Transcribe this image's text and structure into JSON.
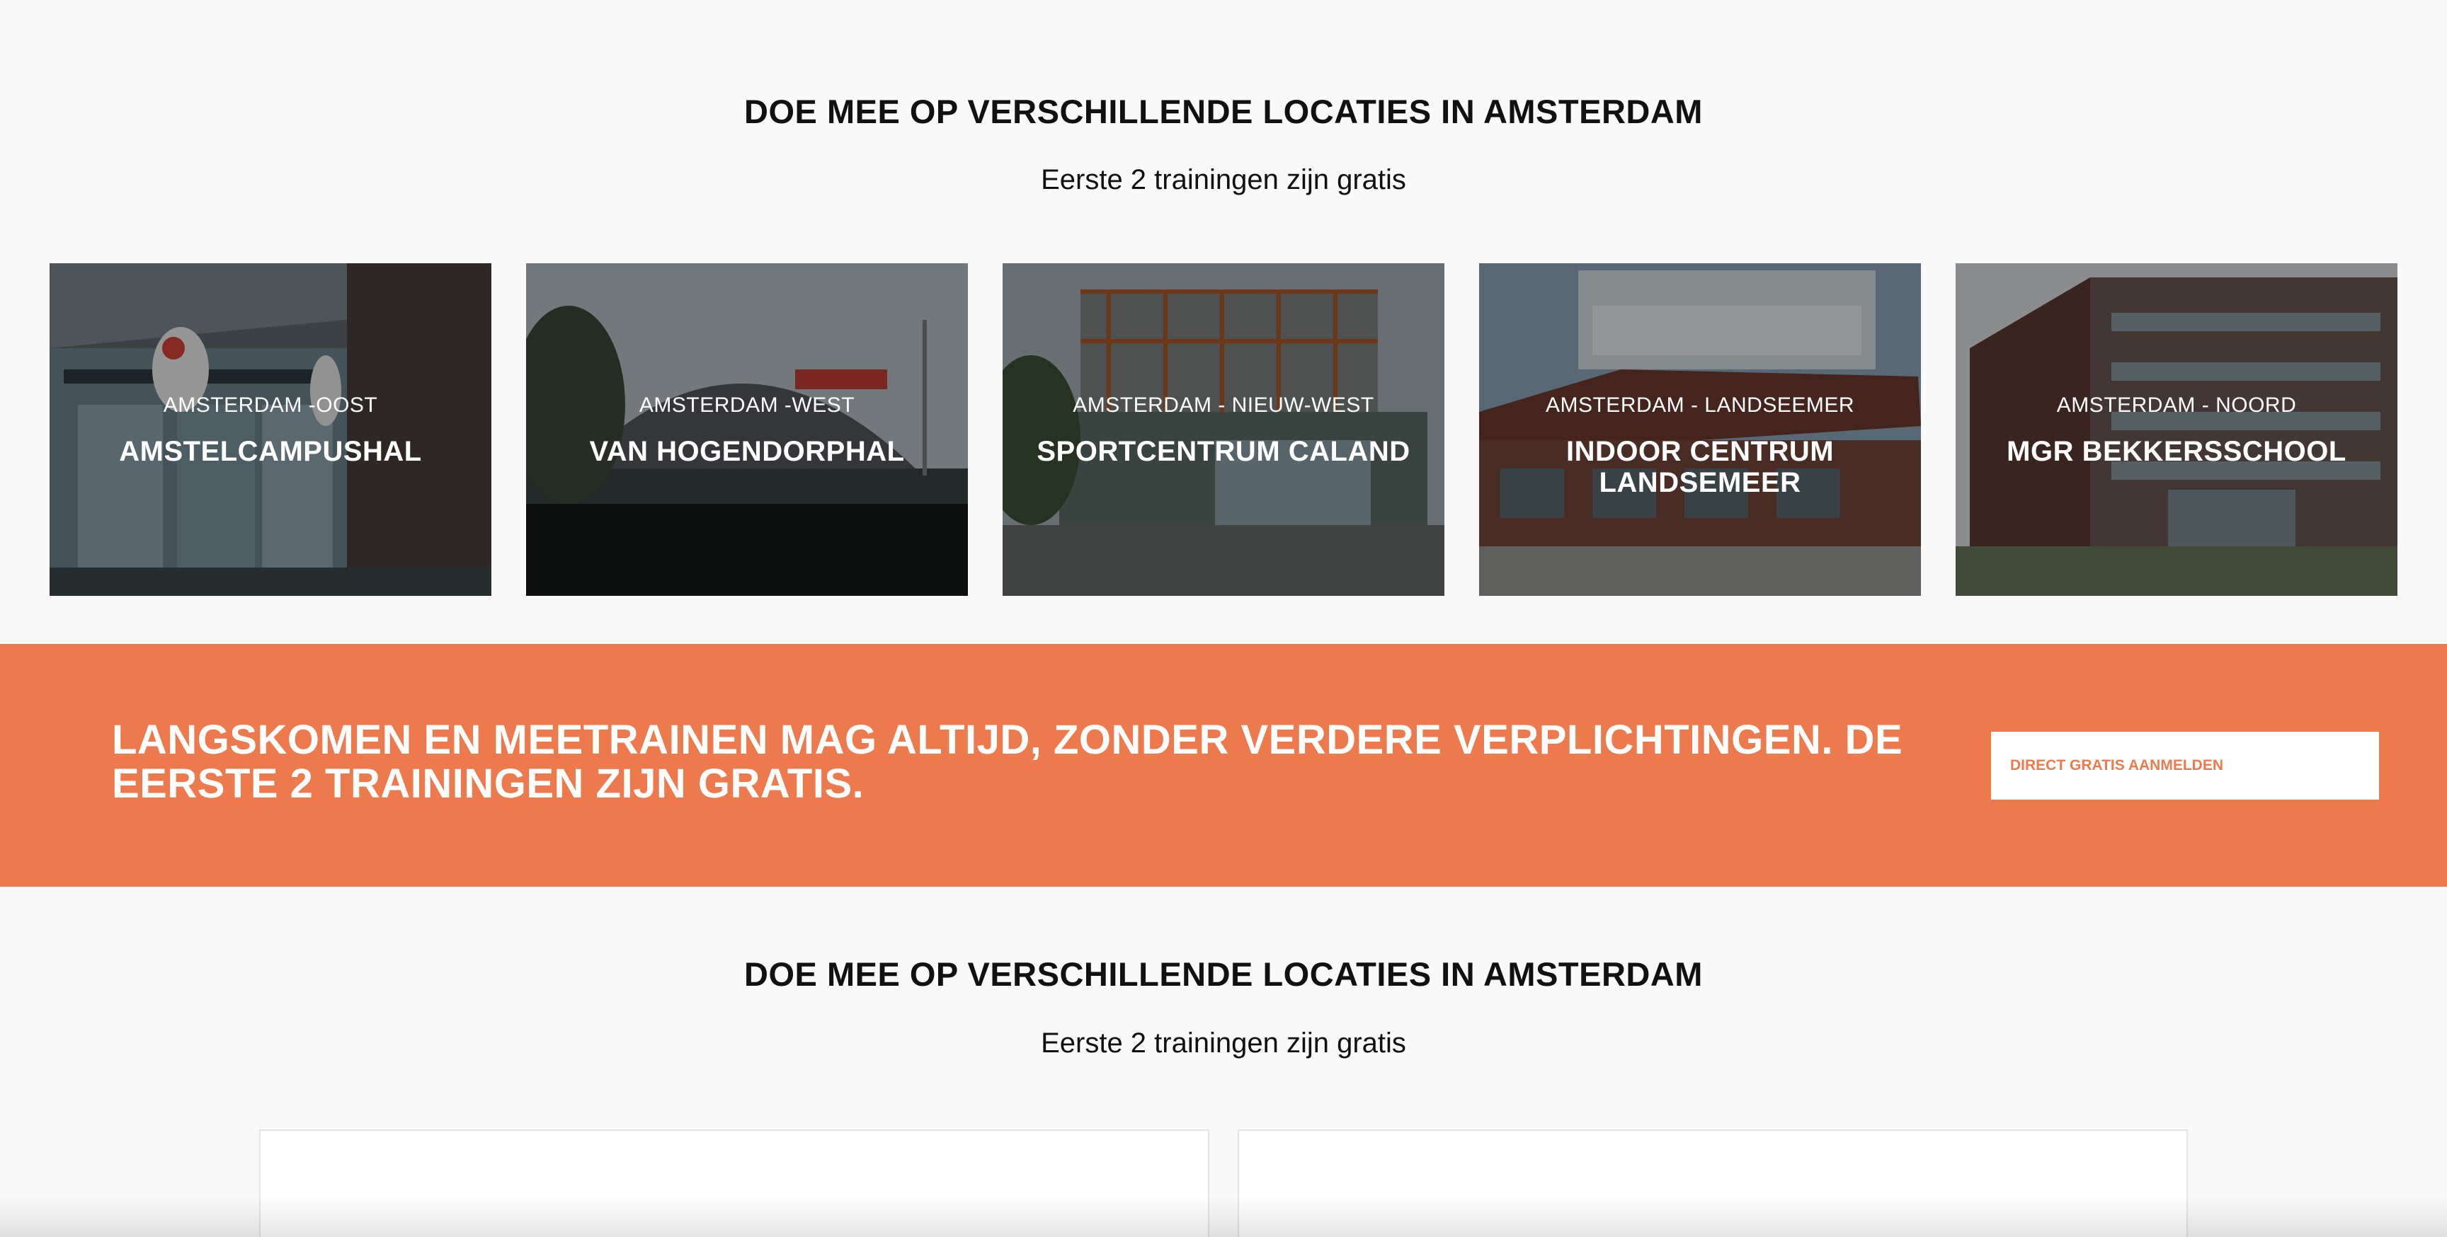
{
  "section1": {
    "title": "DOE MEE OP VERSCHILLENDE LOCATIES IN AMSTERDAM",
    "subtitle": "Eerste 2 trainingen zijn gratis"
  },
  "locations": [
    {
      "area": "AMSTERDAM -OOST",
      "name": "AMSTELCAMPUSHAL"
    },
    {
      "area": "AMSTERDAM -WEST",
      "name": "VAN HOGENDORPHAL"
    },
    {
      "area": "AMSTERDAM - NIEUW-WEST",
      "name": "SPORTCENTRUM CALAND"
    },
    {
      "area": "AMSTERDAM - LANDSEEMER",
      "name": "INDOOR CENTRUM LANDSEMEER"
    },
    {
      "area": "AMSTERDAM - NOORD",
      "name": "MGR BEKKERSSCHOOL"
    }
  ],
  "cta": {
    "text": "LANGSKOMEN EN MEETRAINEN MAG ALTIJD, ZONDER VERDERE VERPLICHTINGEN. DE EERSTE 2 TRAININGEN ZIJN GRATIS.",
    "button_label": "DIRECT GRATIS AANMELDEN",
    "accent": "#ed7a4c"
  },
  "section2": {
    "title": "DOE MEE OP VERSCHILLENDE LOCATIES IN AMSTERDAM",
    "subtitle": "Eerste 2 trainingen zijn gratis"
  }
}
